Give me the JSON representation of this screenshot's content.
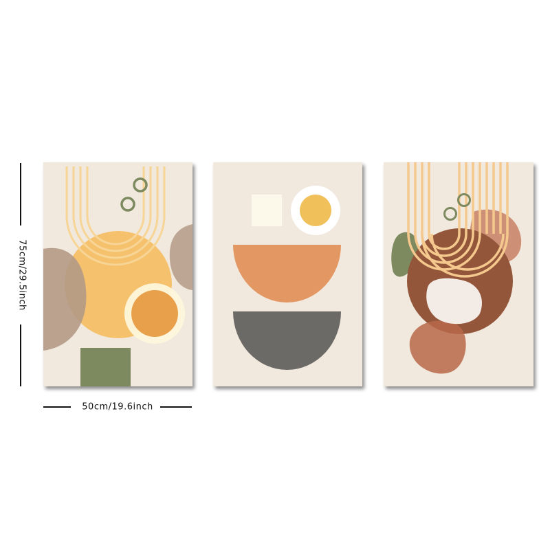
{
  "dimensions": {
    "height_label": "75cm/29.5inch",
    "width_label": "50cm/19.6inch"
  },
  "panels": [
    {
      "subject": "sun arches with orange circle, beige blob, green square"
    },
    {
      "subject": "white square, yellow dot, orange and grey half-bowls"
    },
    {
      "subject": "arches over brown circle, green and terracotta blobs"
    }
  ],
  "palette": {
    "background": "#f1e8de",
    "mustard": "#f5ca7d",
    "orange": "#e8a048",
    "sage": "#7d8a5f",
    "taupe": "#b49a86",
    "terracotta": "#e39763",
    "charcoal": "#6b6a66",
    "brown": "#93563a",
    "cream": "#fdf8ea"
  }
}
